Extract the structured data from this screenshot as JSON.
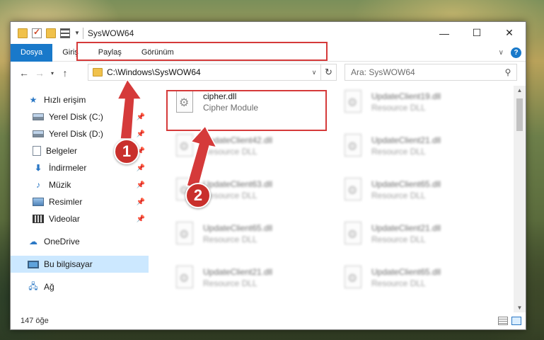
{
  "window": {
    "title": "SysWOW64"
  },
  "ribbon": {
    "tabs": [
      "Dosya",
      "Giriş",
      "Paylaş",
      "Görünüm"
    ],
    "help": "?"
  },
  "address": {
    "path": "C:\\Windows\\SysWOW64"
  },
  "search": {
    "placeholder": "Ara: SysWOW64"
  },
  "sidebar": {
    "items": [
      {
        "label": "Hızlı erişim"
      },
      {
        "label": "Yerel Disk (C:)"
      },
      {
        "label": "Yerel Disk (D:)"
      },
      {
        "label": "Belgeler"
      },
      {
        "label": "İndirmeler"
      },
      {
        "label": "Müzik"
      },
      {
        "label": "Resimler"
      },
      {
        "label": "Videolar"
      },
      {
        "label": "OneDrive"
      },
      {
        "label": "Bu bilgisayar"
      },
      {
        "label": "Ağ"
      }
    ]
  },
  "files": [
    {
      "name": "cipher.dll",
      "type": "Cipher Module"
    },
    {
      "name": "UpdateClient19.dll",
      "type": "Resource DLL"
    },
    {
      "name": "UpdateClient42.dll",
      "type": "Resource DLL"
    },
    {
      "name": "UpdateClient21.dll",
      "type": "Resource DLL"
    },
    {
      "name": "UpdateClient63.dll",
      "type": "Resource DLL"
    },
    {
      "name": "UpdateClient65.dll",
      "type": "Resource DLL"
    },
    {
      "name": "UpdateClient65.dll",
      "type": "Resource DLL"
    },
    {
      "name": "UpdateClient21.dll",
      "type": "Resource DLL"
    },
    {
      "name": "UpdateClient21.dll",
      "type": "Resource DLL"
    },
    {
      "name": "UpdateClient65.dll",
      "type": "Resource DLL"
    }
  ],
  "status": {
    "count": "147 öğe"
  },
  "annotations": {
    "step1": "1",
    "step2": "2",
    "color": "#d53a3a"
  }
}
